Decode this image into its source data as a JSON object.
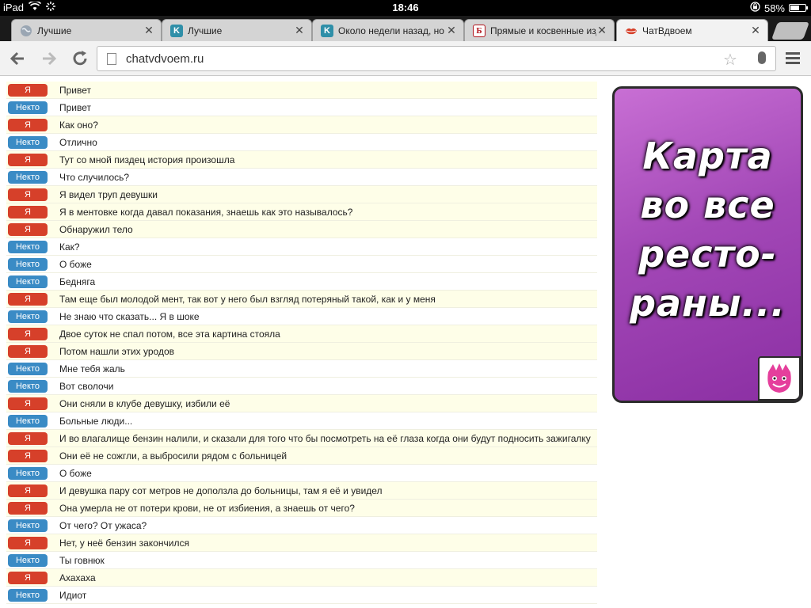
{
  "status": {
    "device": "iPad",
    "time": "18:46",
    "battery": "58%"
  },
  "tabs": [
    {
      "title": "Лучшие",
      "favicon": "globe-icon",
      "active": false
    },
    {
      "title": "Лучшие",
      "favicon": "k-icon",
      "active": false
    },
    {
      "title": "Около недели назад, но",
      "favicon": "k-icon",
      "active": false
    },
    {
      "title": "Прямые и косвенные изд",
      "favicon": "b-icon",
      "active": false
    },
    {
      "title": "ЧатВдвоем",
      "favicon": "lips-icon",
      "active": true
    }
  ],
  "toolbar": {
    "url": "chatvdvoem.ru"
  },
  "chat": {
    "me_label": "Я",
    "other_label": "Некто",
    "messages": [
      {
        "from": "me",
        "text": "Привет"
      },
      {
        "from": "other",
        "text": "Привет"
      },
      {
        "from": "me",
        "text": "Как оно?"
      },
      {
        "from": "other",
        "text": "Отлично"
      },
      {
        "from": "me",
        "text": "Тут со мной пиздец история произошла"
      },
      {
        "from": "other",
        "text": "Что случилось?"
      },
      {
        "from": "me",
        "text": "Я видел труп девушки"
      },
      {
        "from": "me",
        "text": "Я в ментовке когда давал показания, знаешь как это называлось?"
      },
      {
        "from": "me",
        "text": "Обнаружил тело"
      },
      {
        "from": "other",
        "text": "Как?"
      },
      {
        "from": "other",
        "text": "О боже"
      },
      {
        "from": "other",
        "text": "Бедняга"
      },
      {
        "from": "me",
        "text": "Там еще был молодой мент, так вот у него был взгляд потеряный такой, как и у меня"
      },
      {
        "from": "other",
        "text": "Не знаю что сказать... Я в шоке"
      },
      {
        "from": "me",
        "text": "Двое суток не спал потом, все эта картина стояла"
      },
      {
        "from": "me",
        "text": "Потом нашли этих уродов"
      },
      {
        "from": "other",
        "text": "Мне тебя жаль"
      },
      {
        "from": "other",
        "text": "Вот сволочи"
      },
      {
        "from": "me",
        "text": "Они сняли в клубе девушку, избили её"
      },
      {
        "from": "other",
        "text": "Больные люди..."
      },
      {
        "from": "me",
        "text": "И во влагалище бензин налили, и сказали для того что бы посмотреть на её глаза когда они будут подносить зажигалку"
      },
      {
        "from": "me",
        "text": "Они её не сожгли, а выбросили рядом с больницей"
      },
      {
        "from": "other",
        "text": "О боже"
      },
      {
        "from": "me",
        "text": "И девушка пару сот метров не доползла до больницы, там я её и увидел"
      },
      {
        "from": "me",
        "text": "Она умерла не от потери крови, не от избиения, а знаешь от чего?"
      },
      {
        "from": "other",
        "text": "От чего? От ужаса?"
      },
      {
        "from": "me",
        "text": "Нет, у неё бензин закончился"
      },
      {
        "from": "other",
        "text": "Ты говнюк"
      },
      {
        "from": "me",
        "text": "Ахахаха"
      },
      {
        "from": "other",
        "text": "Идиот"
      }
    ]
  },
  "ad": {
    "lines": [
      "Карта",
      "во все",
      "ресто-",
      "раны..."
    ]
  }
}
